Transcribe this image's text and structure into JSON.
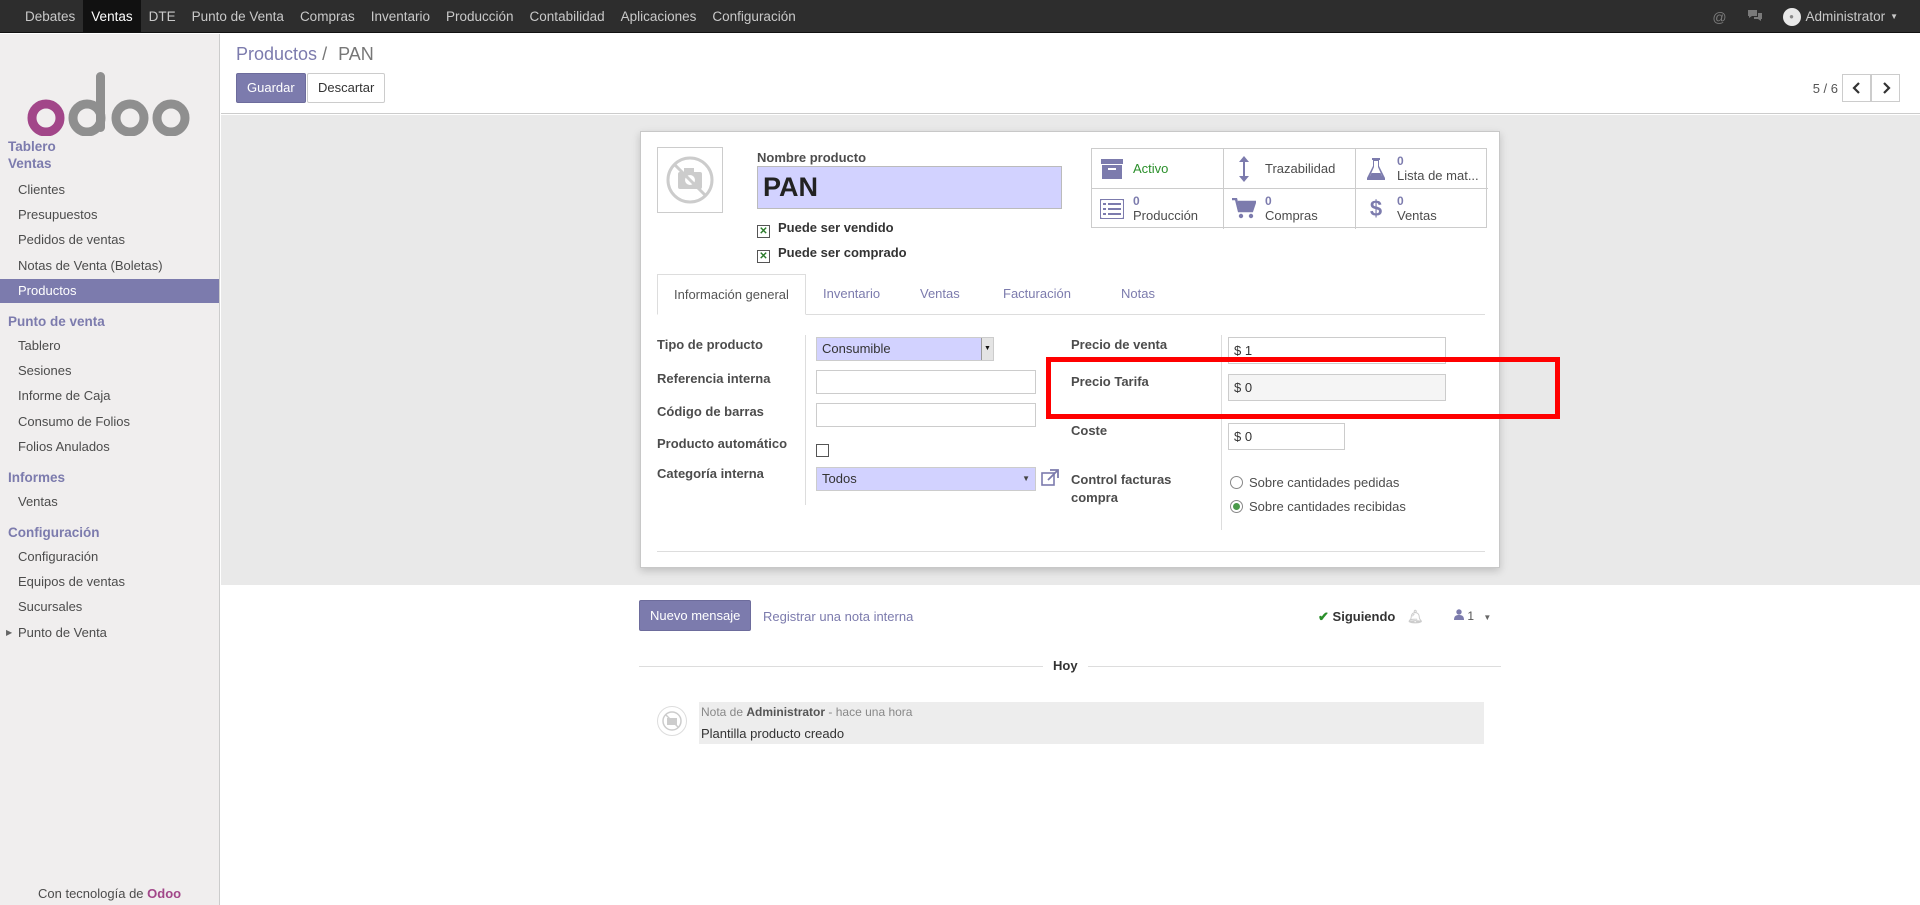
{
  "topbar": {
    "menu": [
      "Debates",
      "Ventas",
      "DTE",
      "Punto de Venta",
      "Compras",
      "Inventario",
      "Producción",
      "Contabilidad",
      "Aplicaciones",
      "Configuración"
    ],
    "active_index": 1,
    "user": "Administrator"
  },
  "sidebar": {
    "logo_text": "odoo",
    "sections": [
      {
        "title": "Tablero"
      },
      {
        "title": "Ventas",
        "items": [
          "Clientes",
          "Presupuestos",
          "Pedidos de ventas",
          "Notas de Venta (Boletas)",
          "Productos"
        ]
      },
      {
        "title": "Punto de venta",
        "items": [
          "Tablero",
          "Sesiones",
          "Informe de Caja",
          "Consumo de Folios",
          "Folios Anulados"
        ]
      },
      {
        "title": "Informes",
        "items": [
          "Ventas"
        ]
      },
      {
        "title": "Configuración",
        "items": [
          "Configuración",
          "Equipos de ventas",
          "Sucursales",
          "Punto de Venta"
        ]
      }
    ],
    "active_item": "Productos",
    "powered_prefix": "Con tecnología de",
    "powered_brand": "Odoo"
  },
  "control_panel": {
    "breadcrumb_parent": "Productos",
    "breadcrumb_sep": "/",
    "breadcrumb_current": "PAN",
    "save_label": "Guardar",
    "discard_label": "Descartar",
    "pager_value": "5 / 6"
  },
  "form": {
    "name_label": "Nombre producto",
    "name_value": "PAN",
    "can_be_sold": "Puede ser vendido",
    "can_be_purchased": "Puede ser comprado",
    "smart_buttons": [
      {
        "icon": "archive-icon",
        "count": "",
        "label": "Activo"
      },
      {
        "icon": "arrows-v-icon",
        "count": "",
        "label": "Trazabilidad"
      },
      {
        "icon": "flask-icon",
        "count": "0",
        "label": "Lista de mat..."
      },
      {
        "icon": "list-icon",
        "count": "0",
        "label": "Producción"
      },
      {
        "icon": "cart-icon",
        "count": "0",
        "label": "Compras"
      },
      {
        "icon": "dollar-icon",
        "count": "0",
        "label": "Ventas"
      }
    ],
    "tabs": [
      "Información general",
      "Inventario",
      "Ventas",
      "Facturación",
      "Notas"
    ],
    "left": {
      "type_label": "Tipo de producto",
      "type_value": "Consumible",
      "ref_label": "Referencia interna",
      "ref_value": "",
      "barcode_label": "Código de barras",
      "barcode_value": "",
      "auto_label": "Producto automático",
      "categ_label": "Categoría interna",
      "categ_value": "Todos"
    },
    "right": {
      "sale_price_label": "Precio de venta",
      "sale_price_value": "$ 1",
      "tariff_label": "Precio Tarifa",
      "tariff_value": "$ 0",
      "cost_label": "Coste",
      "cost_value": "$ 0",
      "control_label_1": "Control facturas",
      "control_label_2": "compra",
      "control_opt1": "Sobre cantidades pedidas",
      "control_opt2": "Sobre cantidades recibidas",
      "control_selected": 2
    }
  },
  "chatter": {
    "new_message": "Nuevo mensaje",
    "log_note": "Registrar una nota interna",
    "following": "Siguiendo",
    "followers": "1",
    "date_sep": "Hoy",
    "message": {
      "prefix": "Nota de",
      "author": "Administrator",
      "time": "- hace una hora",
      "body": "Plantilla producto creado"
    }
  },
  "colors": {
    "brand": "#7c7bad",
    "topbar": "#2d2d2d",
    "highlight": "#ff0000",
    "required_field": "#d2d2ff"
  }
}
